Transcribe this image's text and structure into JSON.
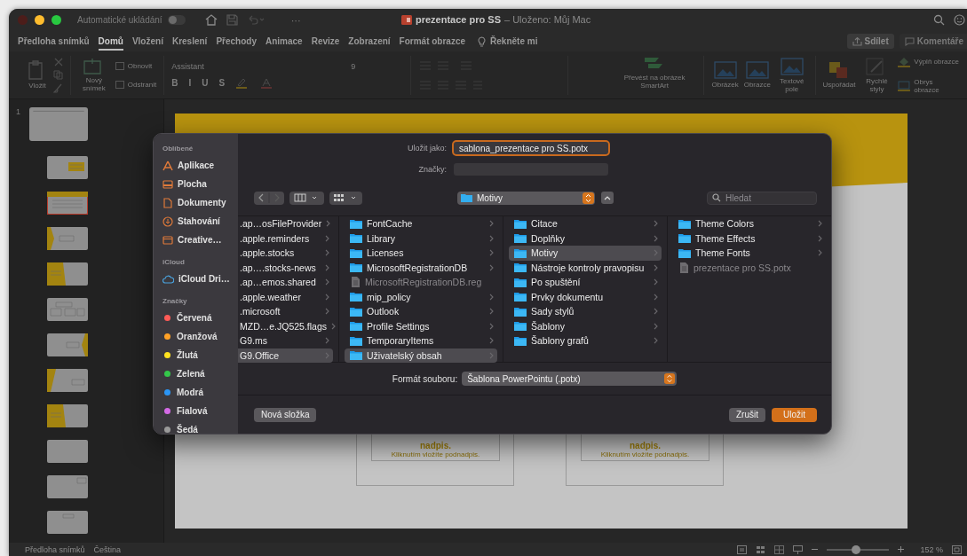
{
  "title_bar": {
    "autosave_label": "Automatické ukládání",
    "autosave_on": false,
    "more": "···",
    "document": "prezentace pro SS",
    "status": "– Uloženo: Můj Mac",
    "traffic_lights": [
      {
        "kind": "close",
        "disabled": true
      },
      {
        "kind": "minimize",
        "disabled": false
      },
      {
        "kind": "zoom",
        "disabled": false
      }
    ]
  },
  "menu_tabs": [
    {
      "label": "Předloha snímků",
      "selected": false
    },
    {
      "label": "Domů",
      "selected": true
    },
    {
      "label": "Vložení",
      "selected": false
    },
    {
      "label": "Kreslení",
      "selected": false
    },
    {
      "label": "Přechody",
      "selected": false
    },
    {
      "label": "Animace",
      "selected": false
    },
    {
      "label": "Revize",
      "selected": false
    },
    {
      "label": "Zobrazení",
      "selected": false
    },
    {
      "label": "Formát obrazce",
      "selected": false
    }
  ],
  "tell_me": "Řekněte mi",
  "share_button": "Sdílet",
  "comments_button": "Komentáře",
  "ribbon": {
    "paste": "Vložit",
    "new_slide": "Nový snímek",
    "reset": "Obnovit",
    "delete": "Odstranit",
    "font": "Assistant",
    "size": "9",
    "format_buttons": [
      "B",
      "I",
      "U",
      "S"
    ],
    "smartart": "Převést na obrázek SmartArt",
    "insert": [
      "Obrázek",
      "Obrazce",
      "Textové pole"
    ],
    "arrange": "Uspořádat",
    "quick_styles": "Rychlé styly",
    "fill": "Výplň obrazce",
    "outline": "Obrys obrazce"
  },
  "thumbnails": [
    {
      "number": "1",
      "kind": "master",
      "selected": false
    },
    {
      "kind": "box-right",
      "selected": false
    },
    {
      "kind": "banner",
      "selected": true
    },
    {
      "kind": "left-tab",
      "selected": false
    },
    {
      "kind": "left-block",
      "selected": false
    },
    {
      "kind": "boxes",
      "selected": false
    },
    {
      "kind": "right-tab",
      "selected": false
    },
    {
      "kind": "left-slant",
      "selected": false
    },
    {
      "kind": "left-block",
      "selected": false
    },
    {
      "kind": "plain",
      "selected": false
    },
    {
      "kind": "corner-box",
      "selected": false
    },
    {
      "kind": "center-box",
      "selected": false
    }
  ],
  "slide": {
    "placeholders": [
      {
        "title": "nadpis.",
        "subtitle": "Kliknutím vložíte podnadpis."
      },
      {
        "title": "nadpis.",
        "subtitle": "Kliknutím vložíte podnadpis."
      }
    ]
  },
  "dialog": {
    "save_as_label": "Uložit jako:",
    "save_as_value": "sablona_prezentace pro SS.potx",
    "tags_label": "Značky:",
    "location": "Motivy",
    "search_placeholder": "Hledat",
    "sidebar": [
      {
        "heading": "Oblíbené",
        "items": [
          {
            "label": "Aplikace",
            "kind": "apps"
          },
          {
            "label": "Plocha",
            "kind": "desktop"
          },
          {
            "label": "Dokumenty",
            "kind": "document"
          },
          {
            "label": "Stahování",
            "kind": "download"
          },
          {
            "label": "Creative…",
            "kind": "folder"
          }
        ]
      },
      {
        "heading": "iCloud",
        "items": [
          {
            "label": "iCloud Dri…",
            "kind": "cloud"
          }
        ]
      },
      {
        "heading": "Značky",
        "items": [
          {
            "label": "Červená",
            "kind": "tag",
            "color": "#ff5b57"
          },
          {
            "label": "Oranžová",
            "kind": "tag",
            "color": "#ffa126"
          },
          {
            "label": "Žlutá",
            "kind": "tag",
            "color": "#ffe21f"
          },
          {
            "label": "Zelená",
            "kind": "tag",
            "color": "#34c74a"
          },
          {
            "label": "Modrá",
            "kind": "tag",
            "color": "#2b95f5"
          },
          {
            "label": "Fialová",
            "kind": "tag",
            "color": "#d46ae6"
          },
          {
            "label": "Šedá",
            "kind": "tag",
            "color": "#9a9a9a"
          }
        ]
      }
    ],
    "columns": [
      [
        {
          "name": ".ap…osFileProvider",
          "kind": "clipped",
          "selected": false
        },
        {
          "name": ".apple.reminders",
          "kind": "clipped",
          "selected": false
        },
        {
          "name": ".apple.stocks",
          "kind": "clipped",
          "selected": false
        },
        {
          "name": ".ap….stocks-news",
          "kind": "clipped",
          "selected": false
        },
        {
          "name": ".ap…emos.shared",
          "kind": "clipped",
          "selected": false
        },
        {
          "name": ".apple.weather",
          "kind": "clipped",
          "selected": false
        },
        {
          "name": ".microsoft",
          "kind": "clipped",
          "selected": false
        },
        {
          "name": "MZD…e.JQ525.flags",
          "kind": "clipped",
          "selected": false
        },
        {
          "name": "G9.ms",
          "kind": "clipped",
          "selected": false
        },
        {
          "name": "G9.Office",
          "kind": "clipped",
          "selected": true
        }
      ],
      [
        {
          "name": "FontCache",
          "kind": "folder",
          "selected": false
        },
        {
          "name": "Library",
          "kind": "folder",
          "selected": false
        },
        {
          "name": "Licenses",
          "kind": "folder",
          "selected": false
        },
        {
          "name": "MicrosoftRegistrationDB",
          "kind": "folder",
          "selected": false
        },
        {
          "name": "MicrosoftRegistrationDB.reg",
          "kind": "file",
          "selected": false
        },
        {
          "name": "mip_policy",
          "kind": "folder",
          "selected": false
        },
        {
          "name": "Outlook",
          "kind": "folder",
          "selected": false
        },
        {
          "name": "Profile Settings",
          "kind": "folder",
          "selected": false
        },
        {
          "name": "TemporaryItems",
          "kind": "folder",
          "selected": false
        },
        {
          "name": "Uživatelský obsah",
          "kind": "folder",
          "selected": true
        }
      ],
      [
        {
          "name": "Citace",
          "kind": "folder",
          "selected": false
        },
        {
          "name": "Doplňky",
          "kind": "folder",
          "selected": false
        },
        {
          "name": "Motivy",
          "kind": "folder",
          "selected": true
        },
        {
          "name": "Nástroje kontroly pravopisu",
          "kind": "folder",
          "selected": false
        },
        {
          "name": "Po spuštění",
          "kind": "folder",
          "selected": false
        },
        {
          "name": "Prvky dokumentu",
          "kind": "folder",
          "selected": false
        },
        {
          "name": "Sady stylů",
          "kind": "folder",
          "selected": false
        },
        {
          "name": "Šablony",
          "kind": "folder",
          "selected": false
        },
        {
          "name": "Šablony grafů",
          "kind": "folder",
          "selected": false
        }
      ],
      [
        {
          "name": "Theme Colors",
          "kind": "folder",
          "selected": false
        },
        {
          "name": "Theme Effects",
          "kind": "folder",
          "selected": false
        },
        {
          "name": "Theme Fonts",
          "kind": "folder",
          "selected": false
        },
        {
          "name": "prezentace pro SS.potx",
          "kind": "file",
          "selected": false
        }
      ]
    ],
    "format_label": "Formát souboru:",
    "format_value": "Šablona PowerPointu (.potx)",
    "new_folder_button": "Nová složka",
    "cancel_button": "Zrušit",
    "save_button": "Uložit"
  },
  "status_bar": {
    "view": "Předloha snímků",
    "language": "Čeština",
    "zoom_slider": {
      "level": 0.47
    },
    "zoom": "152 %"
  }
}
